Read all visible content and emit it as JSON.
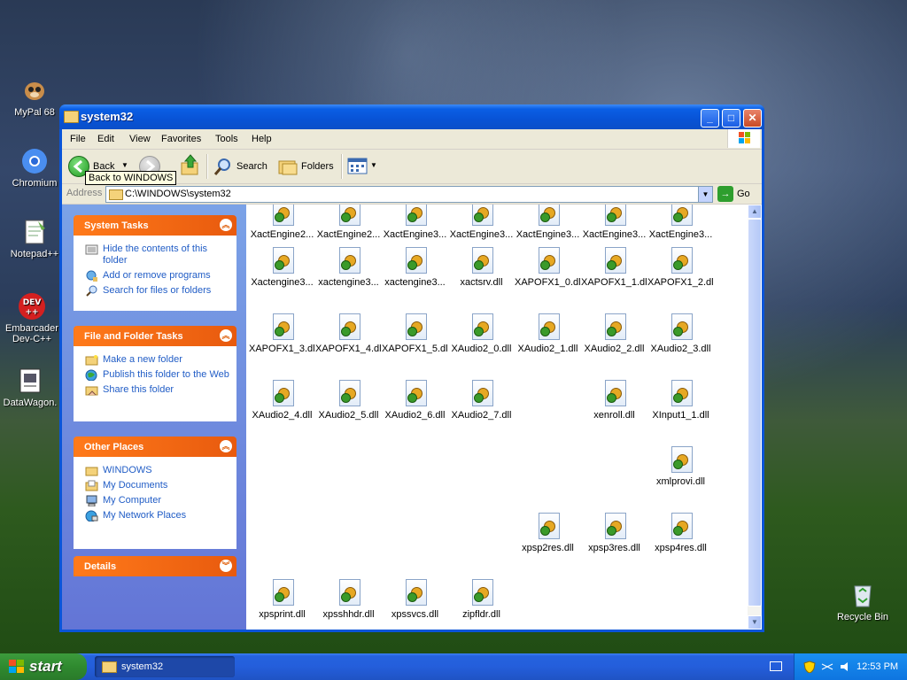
{
  "desktop": {
    "icons": [
      {
        "label": "MyPal 68"
      },
      {
        "label": "Chromium"
      },
      {
        "label": "Notepad++"
      },
      {
        "label": "Embarcadero Dev-C++",
        "line1": "Embarcader",
        "line2": "Dev-C++"
      },
      {
        "label": "DataWagon."
      },
      {
        "label": "Recycle Bin"
      }
    ]
  },
  "window": {
    "title": "system32",
    "controls": {
      "minimize": "_",
      "maximize": "□",
      "close": "✕"
    }
  },
  "menu": [
    "File",
    "Edit",
    "View",
    "Favorites",
    "Tools",
    "Help"
  ],
  "toolbar": {
    "back_label": "Back",
    "search_label": "Search",
    "folders_label": "Folders",
    "tooltip": "Back to WINDOWS"
  },
  "address": {
    "label": "Address",
    "value": "C:\\WINDOWS\\system32",
    "go_label": "Go"
  },
  "taskpane": {
    "system_tasks": {
      "title": "System Tasks",
      "items": [
        "Hide the contents of this folder",
        "Add or remove programs",
        "Search for files or folders"
      ]
    },
    "file_folder_tasks": {
      "title": "File and Folder Tasks",
      "items": [
        "Make a new folder",
        "Publish this folder to the Web",
        "Share this folder"
      ]
    },
    "other_places": {
      "title": "Other Places",
      "items": [
        "WINDOWS",
        "My Documents",
        "My Computer",
        "My Network Places"
      ]
    },
    "details": {
      "title": "Details"
    }
  },
  "files": [
    "XactEngine2...",
    "XactEngine2...",
    "XactEngine3...",
    "XactEngine3...",
    "XactEngine3...",
    "XactEngine3...",
    "XactEngine3...",
    "Xactengine3...",
    "xactengine3...",
    "xactengine3...",
    "xactsrv.dll",
    "XAPOFX1_0.dll",
    "XAPOFX1_1.dll",
    "XAPOFX1_2.dll",
    "XAPOFX1_3.dll",
    "XAPOFX1_4.dll",
    "XAPOFX1_5.dll",
    "XAudio2_0.dll",
    "XAudio2_1.dll",
    "XAudio2_2.dll",
    "XAudio2_3.dll",
    "XAudio2_4.dll",
    "XAudio2_5.dll",
    "XAudio2_6.dll",
    "XAudio2_7.dll",
    "xenroll.dll",
    "XInput1_1.dll",
    "xmlprovi.dll",
    "xpsp2res.dll",
    "xpsp3res.dll",
    "xpsp4res.dll",
    "xpsprint.dll",
    "xpsshhdr.dll",
    "xpssvcs.dll",
    "zipfldr.dll"
  ],
  "taskbar": {
    "start_label": "start",
    "task_label": "system32",
    "clock": "12:53 PM"
  }
}
